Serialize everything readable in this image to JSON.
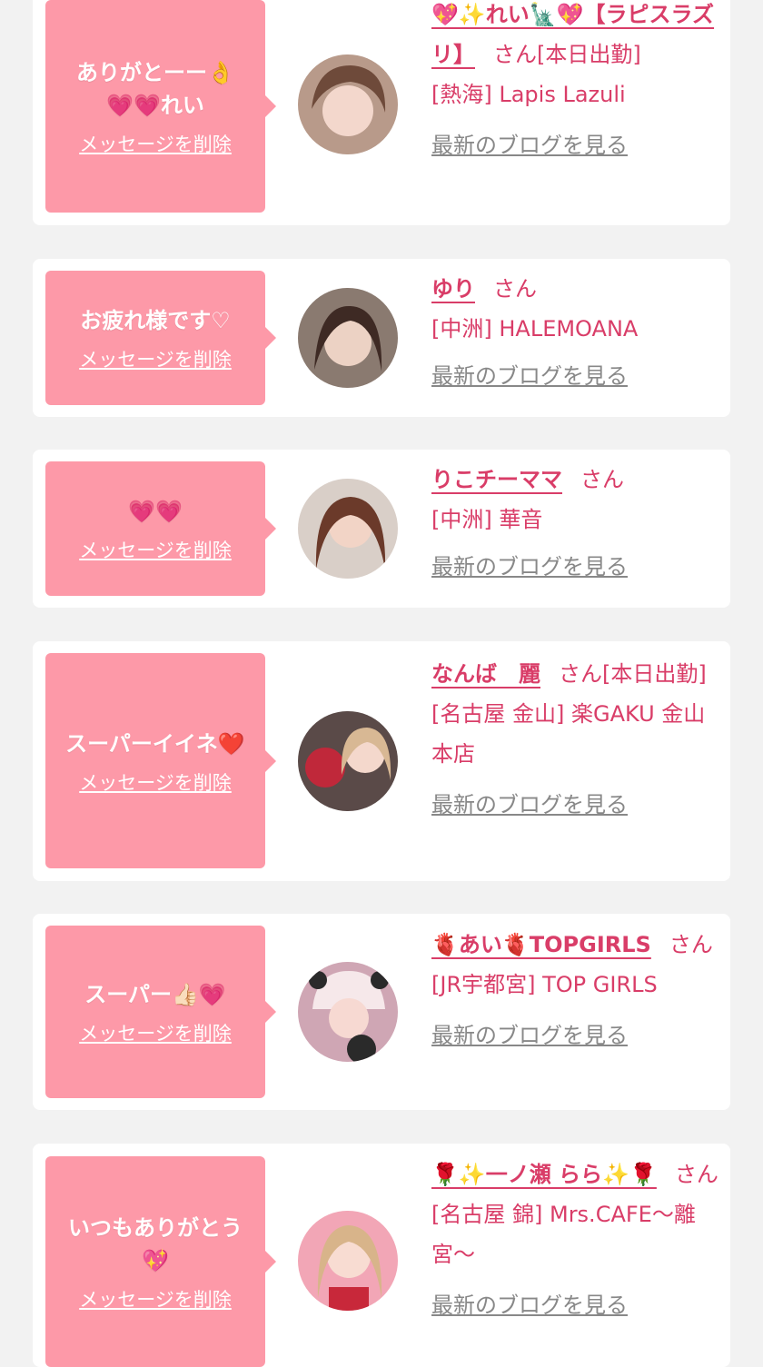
{
  "colors": {
    "background": "#f2f2f2",
    "card": "#ffffff",
    "bubble": "#fd99a8",
    "accent_text": "#d93d68",
    "link_gray": "#888888"
  },
  "delete_label": "メッセージを削除",
  "blog_label": "最新のブログを見る",
  "entries": [
    {
      "message": "ありがとーー👌\n💗💗れい",
      "name": "💖✨れい🗽💖【ラピスラズリ】",
      "suffix": "さん[本日出勤]",
      "shop": "[熱海] Lapis Lazuli",
      "avatar_icon": "avatar-photo"
    },
    {
      "message": "お疲れ様です♡",
      "name": "ゆり",
      "suffix": "さん",
      "shop": "[中洲] HALEMOANA",
      "avatar_icon": "avatar-photo"
    },
    {
      "message": "💗💗",
      "name": "りこチーママ",
      "suffix": "さん",
      "shop": "[中洲] 華音",
      "avatar_icon": "avatar-photo"
    },
    {
      "message": "スーパーイイネ❤️",
      "name": "なんば　麗",
      "suffix": "さん[本日出勤]",
      "shop": "[名古屋 金山] 楽GAKU 金山本店",
      "avatar_icon": "avatar-photo"
    },
    {
      "message": "スーパー👍🏻💗",
      "name": "🫀あい🫀TOPGIRLS",
      "suffix": "さん",
      "shop": "[JR宇都宮] TOP GIRLS",
      "avatar_icon": "avatar-photo"
    },
    {
      "message": "いつもありがとう\n💖",
      "name": "🌹✨一ノ瀬 らら✨🌹",
      "suffix": "さん",
      "shop": "[名古屋 錦] Mrs.CAFE〜離宮〜",
      "avatar_icon": "avatar-photo"
    }
  ]
}
